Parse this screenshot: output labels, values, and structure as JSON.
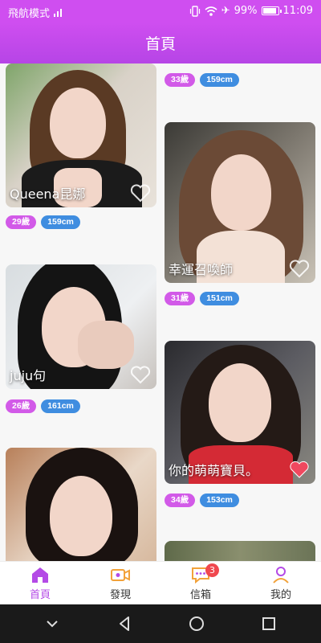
{
  "status_bar": {
    "mode_text": "飛航模式",
    "battery_percent": "99%",
    "time": "11:09"
  },
  "header": {
    "title": "首頁"
  },
  "cards": [
    {
      "name": "Queena昆娜",
      "age": "29歲",
      "height": "159cm"
    },
    {
      "name": "",
      "age": "33歲",
      "height": "159cm"
    },
    {
      "name": "幸運召喚師",
      "age": "31歲",
      "height": "151cm"
    },
    {
      "name": "juju句",
      "age": "26歲",
      "height": "161cm"
    },
    {
      "name": "你的萌萌寶貝。",
      "age": "34歲",
      "height": "153cm"
    }
  ],
  "colors": {
    "accent": "#cf4ef0",
    "tag_age": "#d25ae8",
    "tag_height": "#3f8de0",
    "liked_heart": "#f0485f",
    "badge": "#f0484f"
  },
  "bottom_nav": {
    "items": [
      {
        "label": "首頁",
        "icon": "home-icon",
        "active": true
      },
      {
        "label": "發現",
        "icon": "video-camera-icon",
        "active": false
      },
      {
        "label": "信箱",
        "icon": "message-icon",
        "active": false,
        "badge": "3"
      },
      {
        "label": "我的",
        "icon": "user-icon",
        "active": false
      }
    ]
  }
}
